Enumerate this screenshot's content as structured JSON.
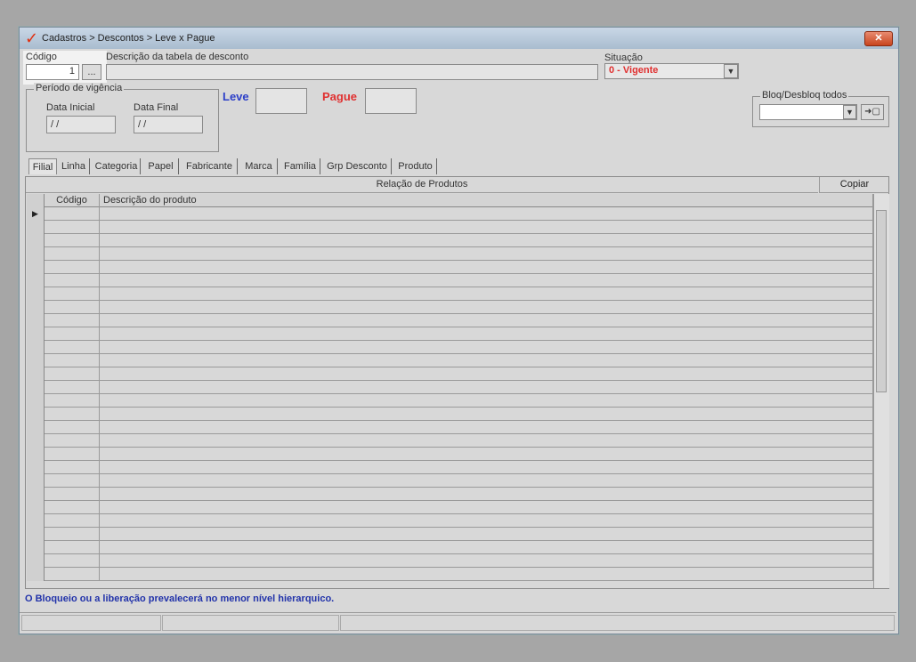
{
  "window": {
    "title": "Cadastros > Descontos > Leve x Pague",
    "logo_glyph": "✓",
    "close_glyph": "✕"
  },
  "form": {
    "codigo_label": "Código",
    "codigo_value": "1",
    "lookup_button": "...",
    "descricao_label": "Descrição da tabela de desconto",
    "descricao_value": "",
    "situacao_label": "Situação",
    "situacao_value": "0 - Vigente",
    "periodo_label": "Período de vigência",
    "data_inicial_label": "Data Inicial",
    "data_inicial_value": "/ /",
    "data_final_label": "Data Final",
    "data_final_value": "/ /",
    "leve_label": "Leve",
    "leve_value": "",
    "pague_label": "Pague",
    "pague_value": "",
    "bloq_label": "Bloq/Desbloq todos",
    "bloq_value": "",
    "bloq_apply_glyph": "➜▢"
  },
  "tabs": [
    "Filial",
    "Linha",
    "Categoria",
    "Papel",
    "Fabricante",
    "Marca",
    "Família",
    "Grp Desconto",
    "Produto"
  ],
  "grid": {
    "title": "Relação de Produtos",
    "copy_button": "Copiar",
    "columns": [
      "Código",
      "Descrição do produto"
    ],
    "current_row_marker": "▶"
  },
  "footer_note": "O Bloqueio ou a liberação prevalecerá no menor nível hierarquico.",
  "colors": {
    "status_red": "#e03030",
    "accent_blue": "#2c3fc8",
    "note_blue": "#2233aa"
  }
}
